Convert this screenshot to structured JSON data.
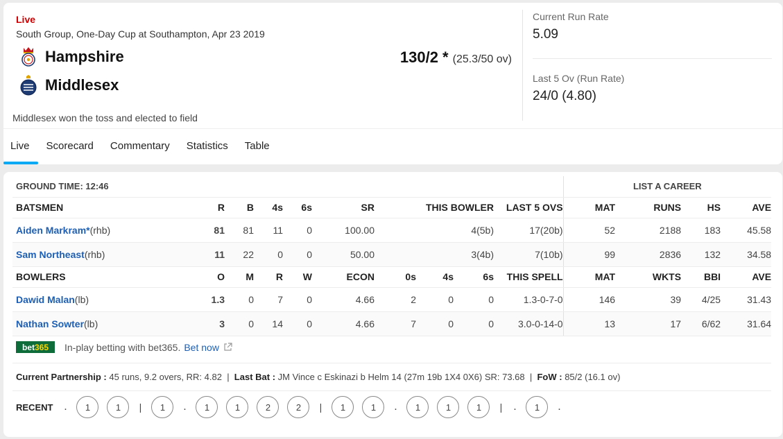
{
  "header": {
    "live_label": "Live",
    "match_desc": "South Group, One-Day Cup at Southampton, Apr 23 2019",
    "team1": "Hampshire",
    "team2": "Middlesex",
    "score_main": "130/2 *",
    "score_overs": "(25.3/50 ov)",
    "toss": "Middlesex won the toss and elected to field",
    "crr_label": "Current Run Rate",
    "crr_value": "5.09",
    "last5_label": "Last 5 Ov (Run Rate)",
    "last5_value": "24/0 (4.80)"
  },
  "tabs": [
    "Live",
    "Scorecard",
    "Commentary",
    "Statistics",
    "Table"
  ],
  "ground_time": "GROUND TIME: 12:46",
  "list_a_career": "LIST A CAREER",
  "batsmen_headers": [
    "BATSMEN",
    "R",
    "B",
    "4s",
    "6s",
    "SR",
    "THIS BOWLER",
    "LAST 5 OVS",
    "MAT",
    "RUNS",
    "HS",
    "AVE"
  ],
  "batsmen": [
    {
      "name": "Aiden Markram*",
      "style": "(rhb)",
      "r": "81",
      "b": "81",
      "fours": "11",
      "sixes": "0",
      "sr": "100.00",
      "this_bowler": "4(5b)",
      "last5": "17(20b)",
      "mat": "52",
      "runs": "2188",
      "hs": "183",
      "ave": "45.58"
    },
    {
      "name": "Sam Northeast",
      "style": "(rhb)",
      "r": "11",
      "b": "22",
      "fours": "0",
      "sixes": "0",
      "sr": "50.00",
      "this_bowler": "3(4b)",
      "last5": "7(10b)",
      "mat": "99",
      "runs": "2836",
      "hs": "132",
      "ave": "34.58"
    }
  ],
  "bowlers_headers": [
    "BOWLERS",
    "O",
    "M",
    "R",
    "W",
    "ECON",
    "0s",
    "4s",
    "6s",
    "THIS SPELL",
    "MAT",
    "WKTS",
    "BBI",
    "AVE"
  ],
  "bowlers": [
    {
      "name": "Dawid Malan",
      "style": "(lb)",
      "o": "1.3",
      "m": "0",
      "r": "7",
      "w": "0",
      "econ": "4.66",
      "zeros": "2",
      "fours": "0",
      "sixes": "0",
      "spell": "1.3-0-7-0",
      "mat": "146",
      "wkts": "39",
      "bbi": "4/25",
      "ave": "31.43"
    },
    {
      "name": "Nathan Sowter",
      "style": "(lb)",
      "o": "3",
      "m": "0",
      "r": "14",
      "w": "0",
      "econ": "4.66",
      "zeros": "7",
      "fours": "0",
      "sixes": "0",
      "spell": "3.0-0-14-0",
      "mat": "13",
      "wkts": "17",
      "bbi": "6/62",
      "ave": "31.64"
    }
  ],
  "bet": {
    "logo_a": "bet",
    "logo_b": "365",
    "text": "In-play betting with bet365.",
    "link": "Bet now",
    "icon": "external-link-icon"
  },
  "partnership": {
    "label": "Current Partnership :",
    "value": "45 runs, 9.2 overs, RR: 4.82",
    "last_bat_label": "Last Bat :",
    "last_bat_value": "JM Vince c Eskinazi b Helm 14 (27m 19b 1X4 0X6) SR: 73.68",
    "fow_label": "FoW :",
    "fow_value": "85/2 (16.1 ov)"
  },
  "recent": {
    "label": "RECENT",
    "items": [
      ".",
      "1",
      "1",
      "|",
      "1",
      ".",
      "1",
      "1",
      "2",
      "2",
      "|",
      "1",
      "1",
      ".",
      "1",
      "1",
      "1",
      "|",
      ".",
      "1",
      "."
    ]
  }
}
